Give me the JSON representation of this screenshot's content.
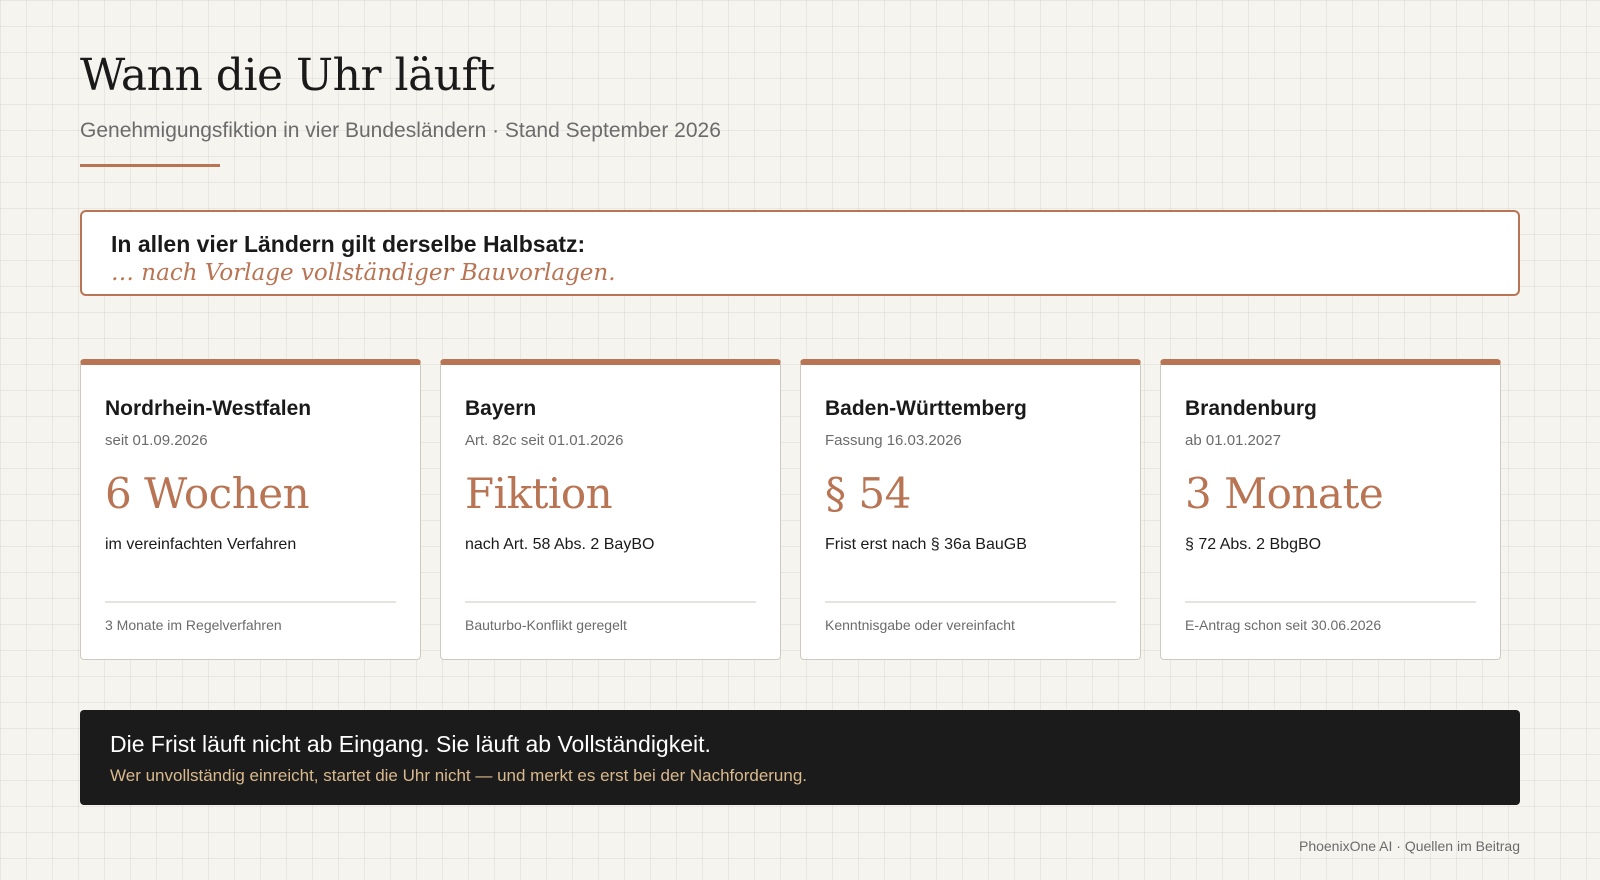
{
  "header": {
    "title": "Wann die Uhr läuft",
    "subtitle": "Genehmigungsfiktion in vier Bundesländern · Stand September 2026"
  },
  "callout": {
    "lead": "In allen vier Ländern gilt derselbe Halbsatz:",
    "quote": "… nach Vorlage vollständiger Bauvorlagen."
  },
  "cards": [
    {
      "name": "Nordrhein-Westfalen",
      "date": "seit 01.09.2026",
      "value": "6 Wochen",
      "desc": "im vereinfachten Verfahren",
      "note": "3 Monate im Regelverfahren"
    },
    {
      "name": "Bayern",
      "date": "Art. 82c seit 01.01.2026",
      "value": "Fiktion",
      "desc": "nach Art. 58 Abs. 2 BayBO",
      "note": "Bauturbo-Konflikt geregelt"
    },
    {
      "name": "Baden-Württemberg",
      "date": "Fassung 16.03.2026",
      "value": "§ 54",
      "desc": "Frist erst nach § 36a BauGB",
      "note": "Kenntnisgabe oder vereinfacht"
    },
    {
      "name": "Brandenburg",
      "date": "ab 01.01.2027",
      "value": "3 Monate",
      "desc": "§ 72 Abs. 2 BbgBO",
      "note": "E-Antrag schon seit 30.06.2026"
    }
  ],
  "banner": {
    "headline": "Die Frist läuft nicht ab Eingang. Sie läuft ab Vollständigkeit.",
    "sub": "Wer unvollständig einreicht, startet die Uhr nicht — und merkt es erst bei der Nachforderung."
  },
  "footer": {
    "text": "PhoenixOne AI · Quellen im Beitrag"
  },
  "colors": {
    "accent": "#b87453",
    "background": "#f6f4ef",
    "banner": "#1b1b1b",
    "banner_sub": "#d9b98e"
  }
}
